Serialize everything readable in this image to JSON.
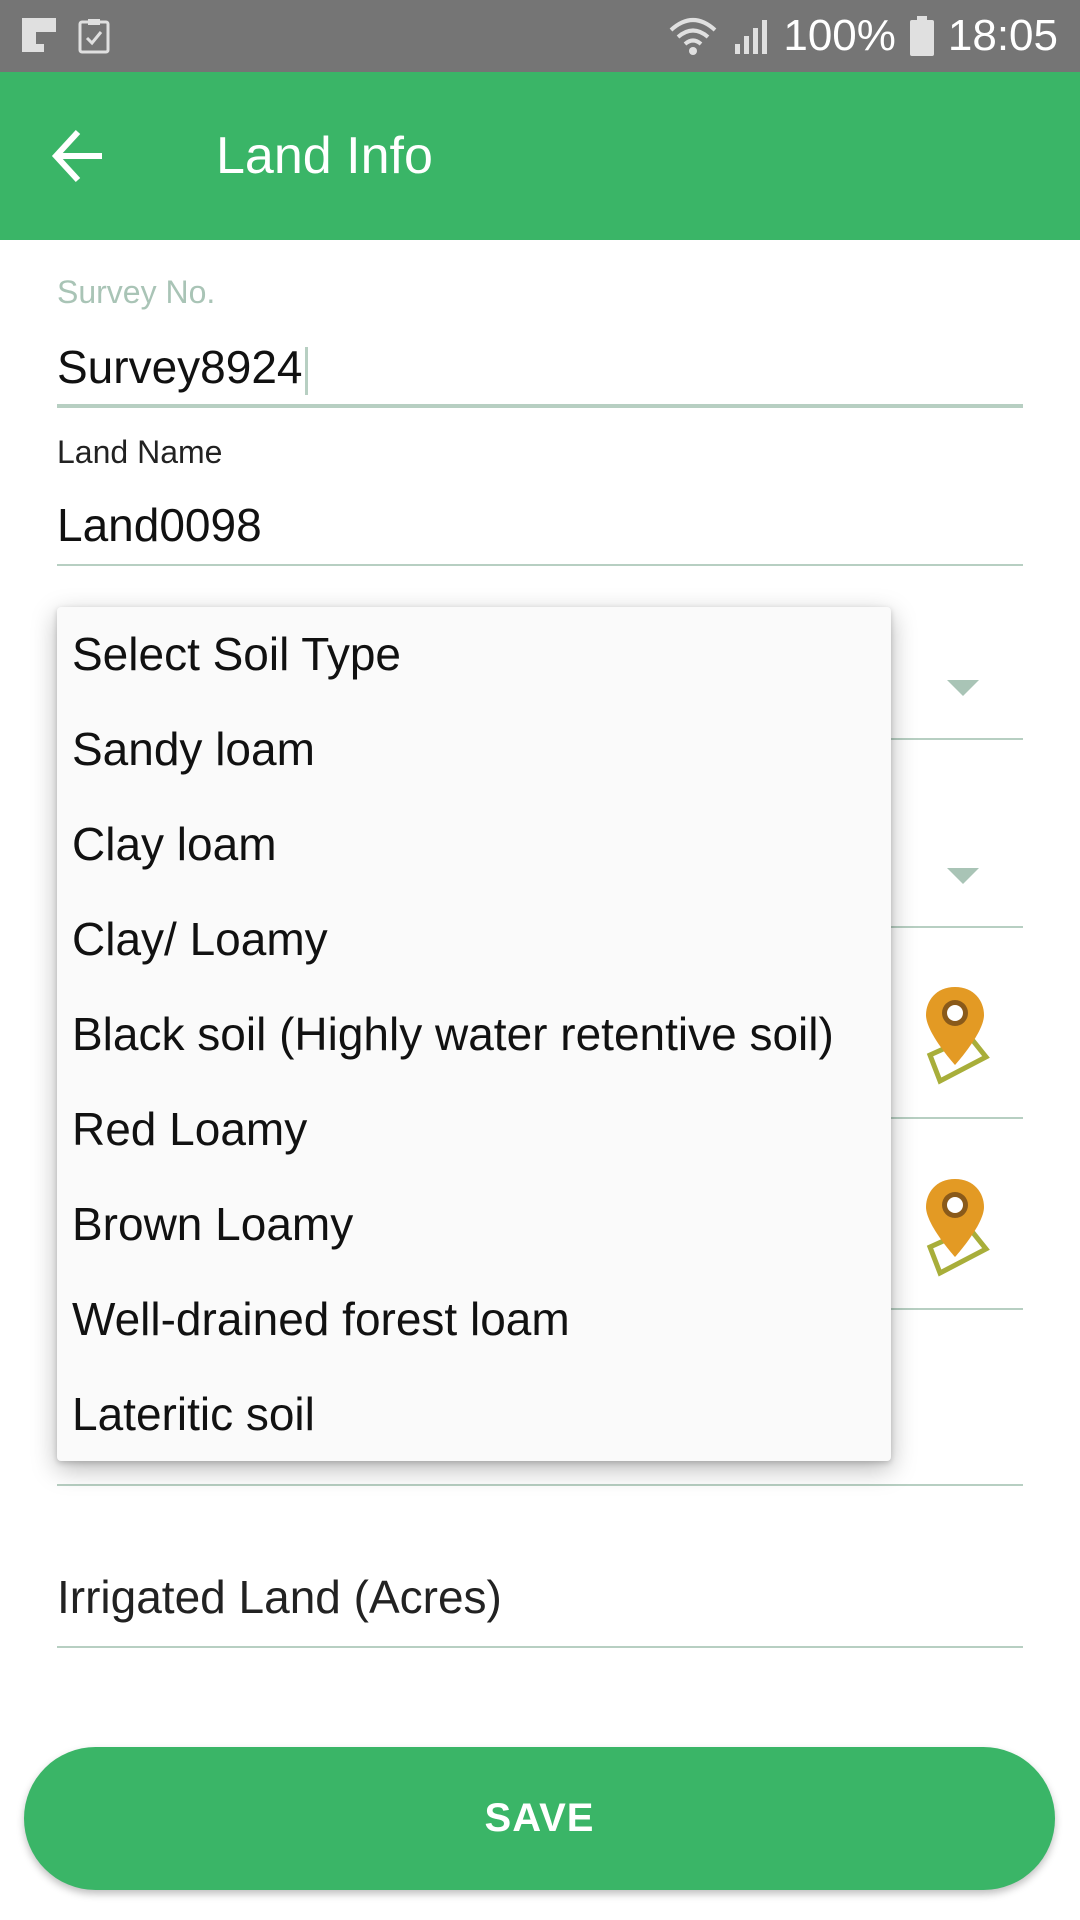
{
  "status_bar": {
    "left_icons": [
      "flipboard-icon",
      "clipboard-check-icon"
    ],
    "battery": "100%",
    "time": "18:05"
  },
  "app_bar": {
    "title": "Land Info",
    "back_icon": "arrow-left-icon"
  },
  "form": {
    "survey_no": {
      "label": "Survey No.",
      "value": "Survey8924"
    },
    "land_name": {
      "label": "Land Name",
      "value": "Land0098"
    },
    "irrigated_land": {
      "placeholder": "Irrigated Land (Acres)"
    }
  },
  "soil_dropdown": {
    "options": [
      "Select Soil Type",
      "Sandy loam",
      "Clay loam",
      "Clay/ Loamy",
      "Black soil (Highly water retentive soil)",
      "Red Loamy",
      "Brown Loamy",
      "Well-drained forest loam",
      "Lateritic soil"
    ]
  },
  "save_button": {
    "label": "SAVE"
  },
  "colors": {
    "primary": "#3ab567",
    "status_bar": "#757575",
    "underline": "#b7cfc2",
    "pin": "#e39a24"
  }
}
